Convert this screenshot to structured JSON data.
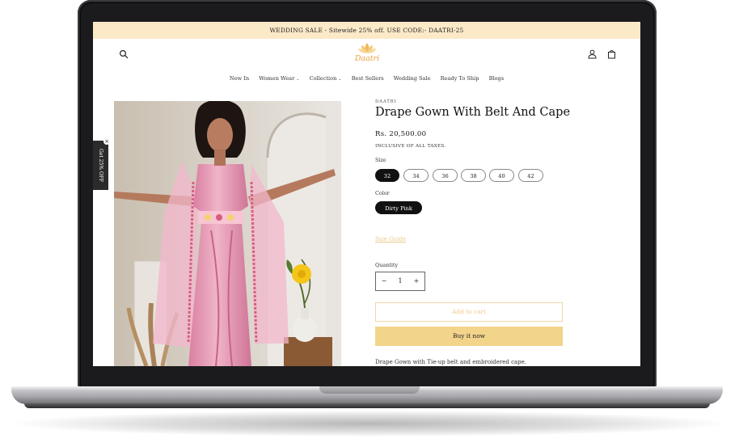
{
  "announcement": "WEDDING SALE - Sitewide 25% off. USE CODE:- DAATRI-25",
  "header": {
    "logo_text": "Daatri",
    "search_icon": "search-icon",
    "account_icon": "user-icon",
    "cart_icon": "bag-icon"
  },
  "nav": [
    {
      "label": "New In"
    },
    {
      "label": "Women Wear",
      "dropdown": true
    },
    {
      "label": "Collection",
      "dropdown": true
    },
    {
      "label": "Best Sellers"
    },
    {
      "label": "Wedding Sale"
    },
    {
      "label": "Ready To Ship"
    },
    {
      "label": "Blogs"
    }
  ],
  "discount_tab": {
    "label": "Get 25% OFF",
    "close": "×"
  },
  "product": {
    "brand": "DAATRI",
    "title": "Drape Gown With Belt And Cape",
    "price": "Rs. 20,500.00",
    "tax_note": "INCLUSIVE OF ALL TAXES.",
    "size_label": "Size",
    "sizes": [
      "32",
      "34",
      "36",
      "38",
      "40",
      "42"
    ],
    "selected_size": "32",
    "color_label": "Color",
    "colors": [
      "Dirty Pink"
    ],
    "size_guide": "Size Guide",
    "quantity_label": "Quantity",
    "quantity": "1",
    "minus": "−",
    "plus": "+",
    "add_to_cart": "Add to cart",
    "buy_now": "Buy it now",
    "description": "Drape Gown with Tie-up belt and embroidered cape."
  },
  "colors": {
    "announcement_bg": "#fbe9c8",
    "accent": "#f2d48a",
    "logo": "#e4a03c",
    "dress_pink": "#e79ab8"
  }
}
